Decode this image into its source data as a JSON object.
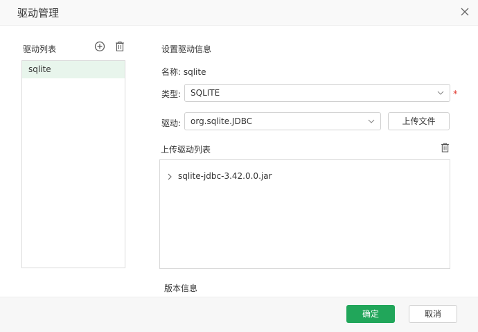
{
  "dialog": {
    "title": "驱动管理"
  },
  "left_panel": {
    "label": "驱动列表",
    "items": [
      {
        "label": "sqlite"
      }
    ]
  },
  "right_panel": {
    "section_title": "设置驱动信息",
    "name_line": "名称: sqlite",
    "type": {
      "label": "类型:",
      "value": "SQLITE",
      "required_mark": "*"
    },
    "driver": {
      "label": "驱动:",
      "value": "org.sqlite.JDBC"
    },
    "upload_button": "上传文件",
    "upload_list_label": "上传驱动列表",
    "files": [
      {
        "name": "sqlite-jdbc-3.42.0.0.jar"
      }
    ],
    "version_label": "版本信息"
  },
  "footer": {
    "ok_label": "确定",
    "cancel_label": "取消"
  },
  "colors": {
    "accent": "#21a65a",
    "selected_row": "#e8f5ec",
    "required": "#e0352b"
  },
  "icons": [
    "close-icon",
    "add-icon",
    "trash-icon",
    "chevron-down-icon",
    "chevron-right-icon"
  ]
}
